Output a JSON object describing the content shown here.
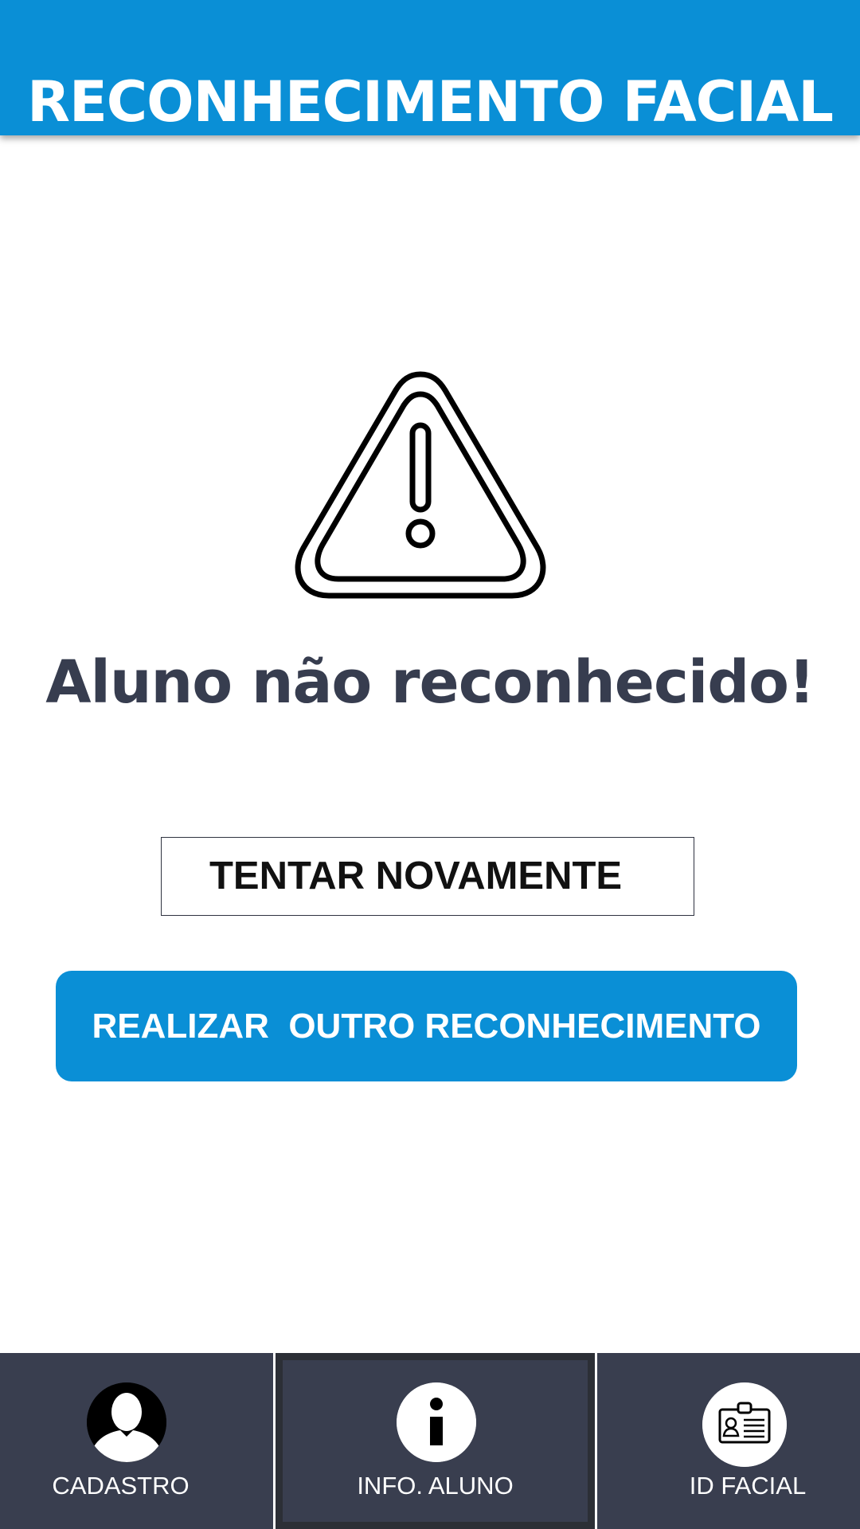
{
  "header": {
    "title": "RECONHECIMENTO FACIAL"
  },
  "main": {
    "status_icon": "warning-triangle-icon",
    "message": "Aluno não reconhecido!",
    "retry_label": "TENTAR NOVAMENTE",
    "primary_label": "REALIZAR  OUTRO RECONHECIMENTO"
  },
  "bottom_nav": {
    "items": [
      {
        "label": "CADASTRO",
        "icon": "user-avatar-icon",
        "active": false
      },
      {
        "label": "INFO. ALUNO",
        "icon": "info-icon",
        "active": true
      },
      {
        "label": "ID FACIAL",
        "icon": "id-card-icon",
        "active": false
      }
    ]
  },
  "colors": {
    "brand_blue": "#0a8fd6",
    "nav_background": "#393e4f",
    "message_text": "#373d4f"
  }
}
